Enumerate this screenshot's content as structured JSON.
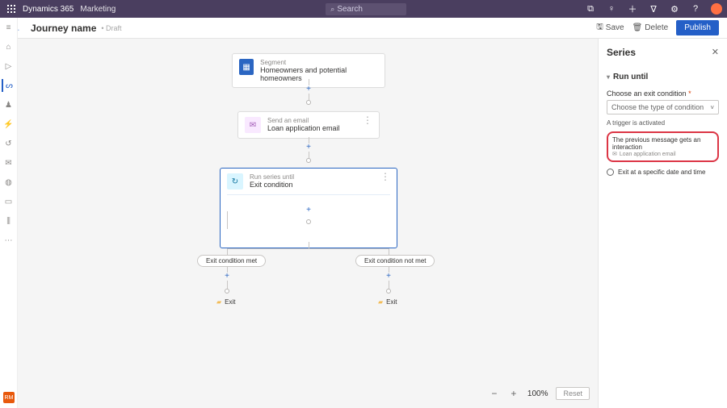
{
  "top": {
    "brand": "Dynamics 365",
    "sub": "Marketing",
    "search_placeholder": "Search"
  },
  "cmd": {
    "back": "←",
    "title": "Journey name",
    "status": "Draft",
    "save": "Save",
    "delete": "Delete",
    "publish": "Publish"
  },
  "nodes": {
    "segment": {
      "label": "Segment",
      "value": "Homeowners and potential homeowners"
    },
    "email": {
      "label": "Send an email",
      "value": "Loan application email"
    },
    "series": {
      "label": "Run series until",
      "value": "Exit condition"
    },
    "pill_met": "Exit condition met",
    "pill_not": "Exit condition not met",
    "exit_a": "Exit",
    "exit_b": "Exit"
  },
  "panel": {
    "title": "Series",
    "section": "Run until",
    "cond_label": "Choose an exit condition",
    "cond_placeholder": "Choose the type of condition",
    "opt_trigger": "A trigger is activated",
    "opt_interaction": "The previous message gets an interaction",
    "opt_interaction_sub": "Loan application email",
    "opt_time": "Exit at a specific date and time"
  },
  "zoom": {
    "value": "100%",
    "reset": "Reset"
  },
  "badge": "RM"
}
